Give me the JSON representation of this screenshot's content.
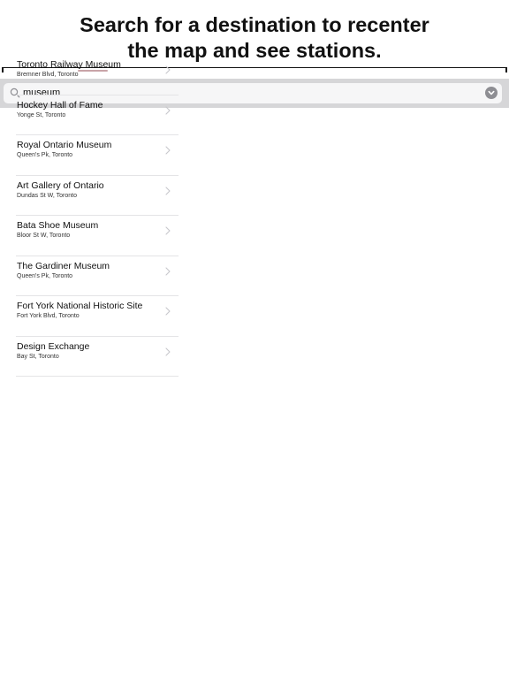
{
  "caption": {
    "line1": "Search for a destination to recenter",
    "line2": "the map and see stations."
  },
  "search": {
    "value": "museum",
    "placeholder": "",
    "icon": "search-icon",
    "clear_icon": "clear-circle-icon"
  },
  "results": [
    {
      "title": "Toronto Railway Museum",
      "subtitle": "Bremner Blvd, Toronto"
    },
    {
      "title": "Hockey Hall of Fame",
      "subtitle": "Yonge St, Toronto"
    },
    {
      "title": "Royal Ontario Museum",
      "subtitle": "Queen's Pk, Toronto"
    },
    {
      "title": "Art Gallery of Ontario",
      "subtitle": "Dundas St W, Toronto"
    },
    {
      "title": "Bata Shoe Museum",
      "subtitle": "Bloor St W, Toronto"
    },
    {
      "title": "The Gardiner Museum",
      "subtitle": "Queen's Pk, Toronto"
    },
    {
      "title": "Fort York National Historic Site",
      "subtitle": "Fort York Blvd, Toronto"
    },
    {
      "title": "Design Exchange",
      "subtitle": "Bay St, Toronto"
    }
  ],
  "colors": {
    "search_bar_background": "#d6d6d8",
    "search_field_background": "#f6f6f7",
    "clear_button": "#8e8e93",
    "separator": "#e4e4e6",
    "chevron": "#c7c7cc"
  }
}
